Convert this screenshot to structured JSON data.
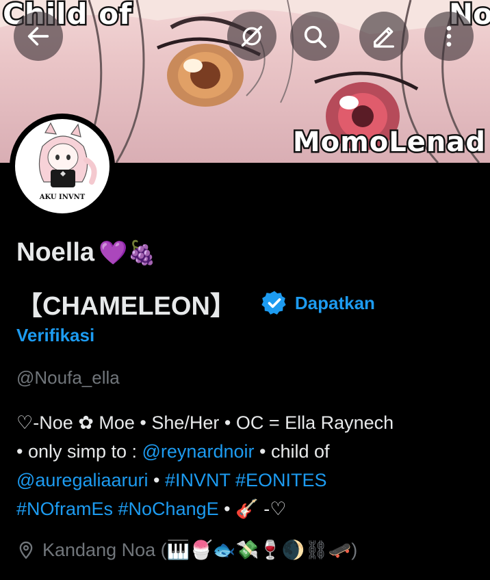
{
  "banner": {
    "text_top_left": "Child of",
    "text_top_right": "No",
    "text_bottom_right": "MomoLenad"
  },
  "toolbar": {
    "back_icon": "arrow-left-icon",
    "translate_icon": "no-sync-icon",
    "search_icon": "search-icon",
    "edit_icon": "pencil-icon",
    "more_icon": "more-vertical-icon"
  },
  "profile": {
    "avatar_caption": "AKU INVNT",
    "name_line1": "Noella",
    "name_emojis": "💜🍇",
    "name_line2": "【CHAMELEON】",
    "verify_label_part1": "Dapatkan",
    "verify_label_part2": "Verifikasi",
    "handle": "@Noufa_ella"
  },
  "bio": {
    "l1": "♡-Noe ✿ Moe • She/Her • OC = Ella Raynech",
    "l2_pre": "• only simp to : ",
    "l2_link": "@reynardnoir",
    "l2_post": " • child of",
    "l3_link": "@auregaliaaruri",
    "l3_mid": " • ",
    "l3_tags": "#INVNT #EONITES",
    "l4_tags": "#NOframEs #NoChangE",
    "l4_post": " • 🎸 -♡"
  },
  "location": {
    "icon": "location-pin-icon",
    "text": "Kandang Noa (🎹🍧🐟💸🍷🌒⛓🛹)"
  },
  "colors": {
    "accent": "#1d9bf0",
    "muted": "#71767b",
    "text": "#e7e9ea",
    "background": "#000000"
  }
}
